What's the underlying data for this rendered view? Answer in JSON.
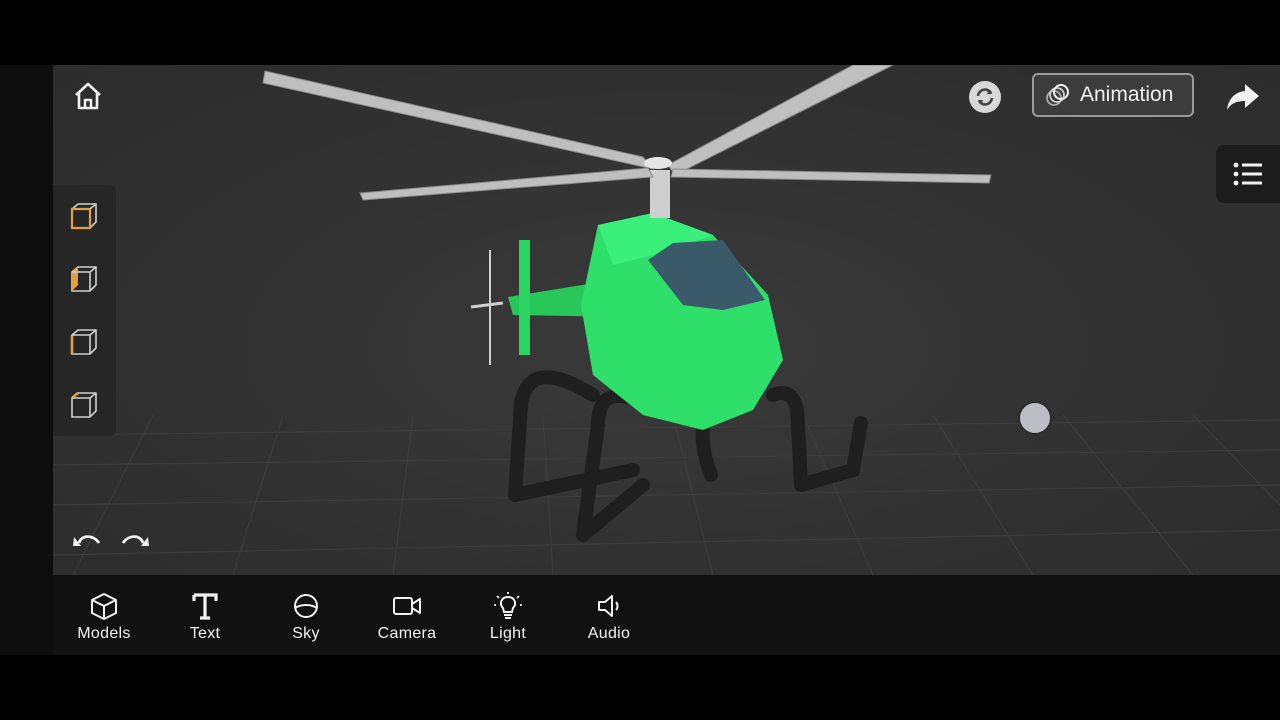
{
  "toolbar_top": {
    "animation_label": "Animation"
  },
  "view_panel": {
    "items": [
      {
        "name": "view-cube-front",
        "accent": "#e0a040"
      },
      {
        "name": "view-cube-left",
        "accent": "#e0a040"
      },
      {
        "name": "view-cube-right",
        "accent": "#e0a040"
      },
      {
        "name": "view-cube-top",
        "accent": "#e0a040"
      }
    ]
  },
  "model": {
    "body_color": "#2ee06a",
    "window_color": "#3a5a6a"
  },
  "bottom_toolbar": {
    "items": [
      {
        "label": "Models",
        "icon": "cube-icon"
      },
      {
        "label": "Text",
        "icon": "text-icon"
      },
      {
        "label": "Sky",
        "icon": "sky-icon"
      },
      {
        "label": "Camera",
        "icon": "camera-icon"
      },
      {
        "label": "Light",
        "icon": "lightbulb-icon"
      },
      {
        "label": "Audio",
        "icon": "speaker-icon"
      }
    ]
  }
}
